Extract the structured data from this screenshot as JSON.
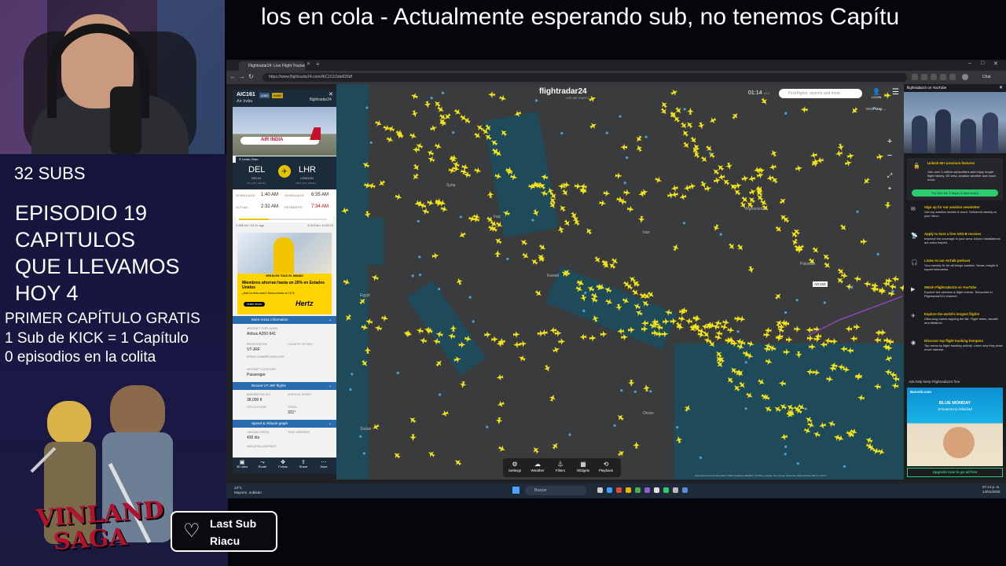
{
  "stream": {
    "ticker_text": "los en cola - Actualmente esperando sub, no tenemos Capítu",
    "subs_count": "32 SUBS",
    "episode_lines": [
      "EPISODIO 19",
      "CAPITULOS",
      "QUE LLEVAMOS",
      "HOY 4"
    ],
    "promo_lines": [
      "PRIMER CAPÍTULO GRATIS",
      "1 Sub de KICK = 1 Capítulo",
      "0 episodios en la colita"
    ],
    "show_logo": [
      "VINLAND",
      "SAGA"
    ],
    "last_sub": {
      "title": "Last Sub",
      "name": "Riacu"
    }
  },
  "browser": {
    "tab_title": "Flightradar24: Live Flight Tracker",
    "url": "https://www.flightradar24.com/AIC161/3de826df",
    "chat_label": "Chat"
  },
  "flight_panel": {
    "flight_code": "AIC161",
    "badge_type": "A359",
    "badge_code": "AI359",
    "airline": "Air India",
    "brand": "flightradar24",
    "photo_logo": "AIR INDIA",
    "photo_credit": "© Lewis Zhao",
    "origin": {
      "code": "DEL",
      "city": "DELHI",
      "tz": "IST (UTC +05:30)"
    },
    "destination": {
      "code": "LHR",
      "city": "LONDON",
      "tz": "GMT (UTC +00:00)"
    },
    "times": {
      "scheduled_label": "SCHEDULED",
      "actual_label": "ACTUAL",
      "estimated_label": "ESTIMATED",
      "dep_scheduled": "1:40 AM",
      "dep_actual": "2:32 AM",
      "arr_scheduled": "6:35 AM",
      "arr_estimated": "7:34 AM"
    },
    "progress": {
      "fraction": 0.34,
      "left": "2,685 km, 04:11 ago",
      "right": "4,023 km, in 05:19"
    },
    "ad": {
      "stripe": "VENTA EN TODO EL MUNDO",
      "headline": "Miembros ahorran hasta un 20% en Estados Unidos",
      "sub": "¿Aún no eres socio? Ahorra hasta un 15 %",
      "cta": "Únete ahora",
      "brand": "Hertz"
    },
    "sections": {
      "more_info": "More AI161 information",
      "recent_flights": "Recent VT-JRF flights",
      "speed_graph": "Speed & Altitude graph"
    },
    "details": {
      "aircraft_type_label": "AIRCRAFT TYPE (A359)",
      "aircraft_type": "Airbus A350-941",
      "registration_label": "REGISTRATION",
      "registration": "VT-JRF",
      "country_label": "COUNTRY OF REG.",
      "serial_label": "SERIAL NUMBER (MSN) AGE",
      "category_label": "AIRCRAFT CATEGORY",
      "category": "Passenger",
      "baro_label": "BAROMETRIC ALT.",
      "baro": "38,000 ft",
      "vspeed_label": "VERTICAL SPEED",
      "gps_label": "GPS ALTITUDE",
      "track_label": "TRACK",
      "track": "321°",
      "gspeed_label": "GROUND SPEED",
      "gspeed": "435 kts",
      "tas_label": "TRUE AIRSPEED",
      "ias_label": "INDICATED AIRSPEED"
    },
    "bottom_actions": [
      "3D view",
      "Route",
      "Follow",
      "Share",
      "More"
    ]
  },
  "map": {
    "brand": "flightradar24",
    "brand_sub": "LIVE AIR TRAFFIC",
    "clock": "01:14",
    "clock_unit": "UTC",
    "search_placeholder": "Find flights, airports and more",
    "login": "LOGIN",
    "view_label": "VIEW",
    "view_value": "Map",
    "selected_flight_tag": "AIC161",
    "controls": [
      "Settings",
      "Weather",
      "Filters",
      "Widgets",
      "Playback"
    ],
    "attribution": "Keyboard shortcuts   Map data ©2026 GeoBasis-DE/BKG (©2009), Google, Inst. Geogr. Nacional, Mapa GISrael   500 km   Terms",
    "places": [
      "Syria",
      "Iraq",
      "Egypt",
      "Kuwait",
      "Afghanistan",
      "Pakistan",
      "Sudan",
      "Oman",
      "Iran"
    ]
  },
  "sidebar": {
    "header": "flightradar24 on YouTube",
    "unlock_title": "Unlock 60+ premium features",
    "unlock_desc": "Join over 1 million subscribers and enjoy longer flight history, 3D view, aviation weather and much more.",
    "unlock_btn": "Try free for 7 days | Learn more",
    "items": [
      {
        "title": "Sign up for our aviation newsletter",
        "desc": "Get top aviation stories & more. Delivered weekly to your inbox."
      },
      {
        "title": "Apply to host a free ADS-B receiver",
        "desc": "Improve the coverage in your area. Airport installations are extra helpful."
      },
      {
        "title": "Listen to our AvTalk podcast",
        "desc": "Your weekly fix for all things aviation. News, insight & expert interviews."
      },
      {
        "title": "Watch Flightradar24 on YouTube",
        "desc": "Explore live streams & flight events. Subscribe to Flightradar24's channel."
      },
      {
        "title": "Explore the world's longest flights",
        "desc": "Ultra-long routes topping the list. Flight times, aircraft and distance."
      },
      {
        "title": "Discover top flight tracking hotspots",
        "desc": "Top areas by flight tracking activity. Learn why they draw much interest."
      }
    ],
    "ad_help": "Ads help keep Flightradar24 free",
    "ad_brand": "Barceló.com",
    "ad_headline": "BLUE MONDAY",
    "ad_tagline": "Encuentra tu felicidad",
    "upgrade": "Upgrade now to go ad free"
  },
  "taskbar": {
    "weather_temp": "23°C",
    "weather_desc": "Mayorm. nublado",
    "search_placeholder": "Buscar",
    "time": "07:14 p. m.",
    "date": "14/01/2026"
  }
}
